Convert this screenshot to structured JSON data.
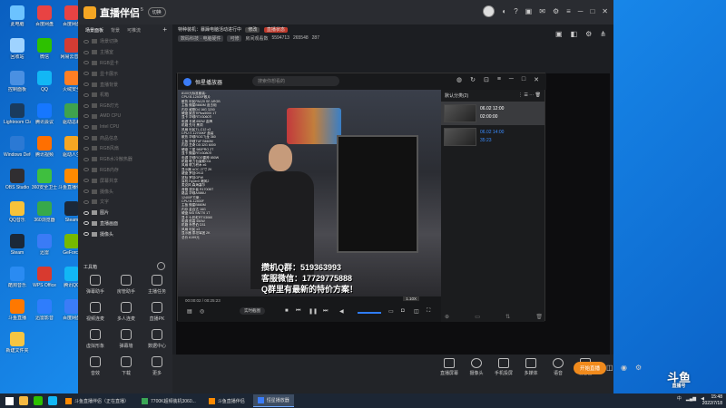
{
  "desktop": {
    "icons": [
      {
        "label": "此电脑",
        "color": "#6cc3ff"
      },
      {
        "label": "百度网盘",
        "color": "#e84343"
      },
      {
        "label": "百度网盘",
        "color": "#e84343"
      },
      {
        "label": "回收站",
        "color": "#9fd3ff"
      },
      {
        "label": "微信",
        "color": "#2dc100"
      },
      {
        "label": "网易云音乐",
        "color": "#d43c33"
      },
      {
        "label": "控制面板",
        "color": "#4a90e2"
      },
      {
        "label": "QQ",
        "color": "#12b7f5"
      },
      {
        "label": "火绒安全",
        "color": "#ff7f24"
      },
      {
        "label": "Lightroom Classic",
        "color": "#1a3b5d"
      },
      {
        "label": "腾讯会议",
        "color": "#1677ff"
      },
      {
        "label": "驱动总裁",
        "color": "#3fa34d"
      },
      {
        "label": "Windows Defender",
        "color": "#2b79d4"
      },
      {
        "label": "腾讯视频",
        "color": "#ff6f00"
      },
      {
        "label": "驱动人生",
        "color": "#f5a623"
      },
      {
        "label": "OBS Studio",
        "color": "#302e31"
      },
      {
        "label": "360安全卫士",
        "color": "#3fbf3f"
      },
      {
        "label": "斗鱼直播伴侣",
        "color": "#ff8a00"
      },
      {
        "label": "QQ音乐",
        "color": "#f6c23a"
      },
      {
        "label": "360浏览器",
        "color": "#37a94a"
      },
      {
        "label": "Steam",
        "color": "#1b2838"
      },
      {
        "label": "Steam",
        "color": "#1b2838"
      },
      {
        "label": "迅雷",
        "color": "#3a7bf6"
      },
      {
        "label": "GeForce",
        "color": "#76b900"
      },
      {
        "label": "酷狗音乐",
        "color": "#2a8bf2"
      },
      {
        "label": "WPS Office",
        "color": "#d83a2f"
      },
      {
        "label": "腾讯QQ",
        "color": "#12b7f5"
      },
      {
        "label": "斗鱼直播",
        "color": "#ff7800"
      },
      {
        "label": "迅雷影音",
        "color": "#2f7dfc"
      },
      {
        "label": "百度网盘",
        "color": "#3b7cf7"
      },
      {
        "label": "新建文件夹",
        "color": "#f5c542"
      }
    ]
  },
  "app": {
    "name": "直播伴侣",
    "version": "5",
    "switch_label": "切换",
    "left_tabs": [
      "场景面板",
      "背景",
      "可推流"
    ],
    "scenes": [
      {
        "label": "场景切换",
        "on": false
      },
      {
        "label": "主播室",
        "on": false
      },
      {
        "label": "RGB显卡",
        "on": false
      },
      {
        "label": "显卡展示",
        "on": false
      },
      {
        "label": "直播背景",
        "on": false
      },
      {
        "label": "机箱",
        "on": false
      },
      {
        "label": "RGB灯光",
        "on": false
      },
      {
        "label": "AMD CPU",
        "on": false
      },
      {
        "label": "Intel CPU",
        "on": false
      },
      {
        "label": "商品信息",
        "on": false
      },
      {
        "label": "RGB风扇",
        "on": false
      },
      {
        "label": "RGB水冷散热器",
        "on": false
      },
      {
        "label": "RGB内存",
        "on": false
      },
      {
        "label": "屏幕共享",
        "on": false
      },
      {
        "label": "摄像头",
        "on": false
      },
      {
        "label": "文字",
        "on": false
      },
      {
        "label": "图片",
        "on": true
      },
      {
        "label": "直播画面",
        "on": true
      },
      {
        "label": "摄像头",
        "on": true
      }
    ],
    "toolbox_title": "工具箱",
    "tools": [
      "弹幕助手",
      "房管助手",
      "主播任务",
      "视频连麦",
      "多人连麦",
      "直播PK",
      "虚拟形象",
      "弹幕墙",
      "数据中心",
      "音效",
      "下载",
      "更多"
    ],
    "room_title": "特种装机：暴躁电脑活动进行中",
    "room_tag": "修改",
    "room_tag2": "直播状态",
    "category": "数码科技 · 电脑硬件",
    "category_edit": "可修",
    "room_label": "房间观看数",
    "room_id": "5594713",
    "fans": "265548",
    "online": "287",
    "bottom_buttons": [
      "直播屏幕",
      "摄像头",
      "手机投屏",
      "多媒体",
      "语音",
      "混音器"
    ],
    "start_label": "开始直播",
    "watermark_text": "斗鱼",
    "watermark_sub": "直播号"
  },
  "player": {
    "title": "恒星播放器",
    "search_placeholder": "搜索你想看的",
    "time": "00:00:02 / 00:25:23",
    "speed": "1.10X",
    "screenshot_label": "实时截图",
    "playlist_title": "默认分类(2)",
    "playlist": [
      {
        "date": "06.02 12:00",
        "time": "02:00:00",
        "selected": true
      },
      {
        "date": "06.02 14:00",
        "time": "35:23",
        "selected": false
      }
    ]
  },
  "video": {
    "overlay_lines": [
      "8100元标准套装：",
      "CPU i5-12400F散片",
      "散热 利民PA120 SE ARGB",
      "主板 微星B660M 迫击炮",
      "内存 威刚D4 16G 3200",
      "硬盘 致态TiPlus5000 1T",
      "显卡 华硕RTX3060Ti",
      "电源 长城 650W 金牌",
      "机箱 先马 黑洞",
      "风扇 利民TL-C12 x3",
      "CPU i7-12700KF 盒装",
      "散热 华硕ROG飞龙 360",
      "主板 华硕TUF B660M",
      "内存 芝奇 D5 32G 6000",
      "硬盘 三星 980PRO 2T",
      "显卡 微星RTX3080Ti",
      "电源 华硕ROG雷神 850W",
      "机箱 联力包豪斯O11",
      "风扇 联力积木 x6",
      "显示器 AOC 27寸 2K",
      "键盘 罗技G913",
      "鼠标 罗技GPW",
      "耳机 HyperX 飓风2",
      "麦克风 森海塞尔",
      "音箱 漫步者 R1700BT",
      "路由 华硕AX86U",
      "12400F方案：",
      "CPU i5-12400F",
      "主板 微星B660M",
      "内存 金百达 16G",
      "硬盘 WD SN770 1T",
      "显卡 七彩虹RTX3060",
      "电源 航嘉 550W",
      "机箱 乔思伯 D31",
      "风扇 利民 x3",
      "显示器 泰坦军团 2K",
      "总价 6199元"
    ],
    "promo_lines": [
      "攒机Q群：519363993",
      "客服微信：17729775888",
      "Q群里有最新的特价方案！"
    ]
  },
  "taskbar": {
    "apps": [
      {
        "label": "斗鱼直播伴侣（正在直播）",
        "color": "#ff8a00",
        "active": false
      },
      {
        "label": "7700K超频装机3060...",
        "color": "#3aa655",
        "active": false
      },
      {
        "label": "斗鱼直播伴侣",
        "color": "#ff8a00",
        "active": false
      },
      {
        "label": "恒星播放器",
        "color": "#3b7cf7",
        "active": true
      }
    ],
    "tray_text": "中",
    "time": "15:48",
    "date": "2022/7/18"
  },
  "colors": {
    "accent": "#f08a1c",
    "player_blue": "#3b8cff",
    "desktop_blue": "#1a8ef0"
  }
}
